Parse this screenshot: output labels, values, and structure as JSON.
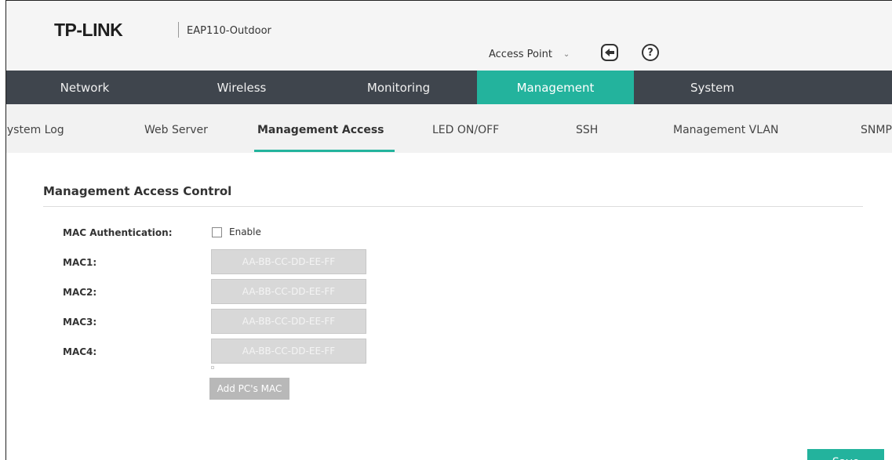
{
  "header": {
    "brand": "TP-LINK",
    "model": "EAP110-Outdoor",
    "mode": "Access Point",
    "help_glyph": "?"
  },
  "main_nav": {
    "tabs": [
      {
        "label": "Network"
      },
      {
        "label": "Wireless"
      },
      {
        "label": "Monitoring"
      },
      {
        "label": "Management"
      },
      {
        "label": "System"
      }
    ],
    "active": "Management"
  },
  "sub_nav": {
    "tabs": [
      {
        "label": "System Log"
      },
      {
        "label": "Web Server"
      },
      {
        "label": "Management Access"
      },
      {
        "label": "LED ON/OFF"
      },
      {
        "label": "SSH"
      },
      {
        "label": "Management VLAN"
      },
      {
        "label": "SNMP"
      }
    ],
    "active": "Management Access"
  },
  "section": {
    "title": "Management Access Control"
  },
  "form": {
    "mac_auth_label": "MAC Authentication:",
    "enable_label": "Enable",
    "enable_checked": false,
    "mac_fields": [
      {
        "label": "MAC1:",
        "placeholder": "AA-BB-CC-DD-EE-FF",
        "value": ""
      },
      {
        "label": "MAC2:",
        "placeholder": "AA-BB-CC-DD-EE-FF",
        "value": ""
      },
      {
        "label": "MAC3:",
        "placeholder": "AA-BB-CC-DD-EE-FF",
        "value": ""
      },
      {
        "label": "MAC4:",
        "placeholder": "AA-BB-CC-DD-EE-FF",
        "value": ""
      }
    ],
    "add_pc_mac_label": "Add PC's MAC",
    "save_label": "Save"
  },
  "colors": {
    "accent": "#23b39d",
    "nav_bg": "#3f454d",
    "header_bg": "#f5f5f5",
    "subnav_bg": "#f2f2f2",
    "disabled_input": "#d8d8d8",
    "disabled_button": "#b8b8b8"
  }
}
